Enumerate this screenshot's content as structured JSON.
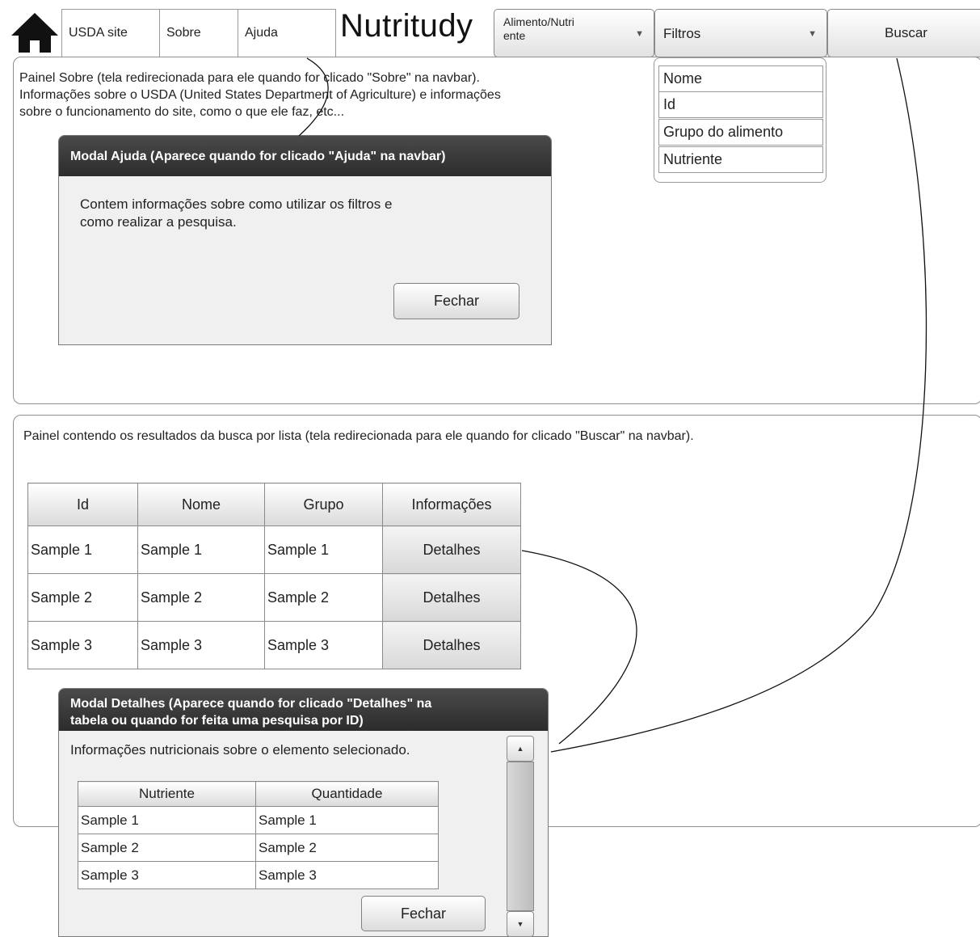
{
  "navbar": {
    "home_icon": "home-icon",
    "links": [
      "USDA site",
      "Sobre",
      "Ajuda"
    ],
    "brand": "Nutritudy",
    "type_select": "Alimento/Nutri\nente",
    "filters_select": "Filtros",
    "search_button": "Buscar"
  },
  "filters_dropdown": {
    "options": [
      "Nome",
      "Id",
      "Grupo do alimento",
      "Nutriente"
    ]
  },
  "about_panel": {
    "text": "Painel Sobre (tela redirecionada para ele quando for clicado \"Sobre\" na navbar).\nInformações sobre o USDA (United States Department of Agriculture) e informações\nsobre o funcionamento do site, como o que ele faz, etc..."
  },
  "help_modal": {
    "title": "Modal Ajuda (Aparece quando for clicado \"Ajuda\" na navbar)",
    "body": "Contem informações sobre como utilizar os filtros e\ncomo realizar a pesquisa.",
    "close_button": "Fechar"
  },
  "results_panel": {
    "text": "Painel contendo os resultados da busca por lista (tela redirecionada para ele quando for clicado \"Buscar\" na navbar).",
    "table": {
      "headers": [
        "Id",
        "Nome",
        "Grupo",
        "Informações"
      ],
      "rows": [
        [
          "Sample 1",
          "Sample 1",
          "Sample 1",
          "Detalhes"
        ],
        [
          "Sample 2",
          "Sample 2",
          "Sample 2",
          "Detalhes"
        ],
        [
          "Sample 3",
          "Sample 3",
          "Sample 3",
          "Detalhes"
        ]
      ]
    }
  },
  "details_modal": {
    "title": "Modal Detalhes (Aparece quando for clicado \"Detalhes\" na\ntabela ou quando for feita uma pesquisa por ID)",
    "body": "Informações nutricionais sobre o elemento selecionado.",
    "table": {
      "headers": [
        "Nutriente",
        "Quantidade"
      ],
      "rows": [
        [
          "Sample 1",
          "Sample 1"
        ],
        [
          "Sample 2",
          "Sample 2"
        ],
        [
          "Sample 3",
          "Sample 3"
        ]
      ]
    },
    "close_button": "Fechar",
    "scroll_up_icon": "triangle-up-icon",
    "scroll_down_icon": "triangle-down-icon"
  }
}
